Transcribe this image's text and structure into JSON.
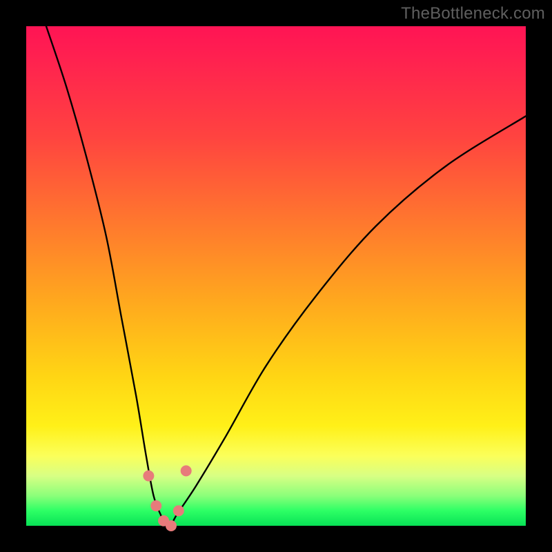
{
  "watermark": "TheBottleneck.com",
  "chart_data": {
    "type": "line",
    "title": "",
    "xlabel": "",
    "ylabel": "",
    "xlim": [
      0,
      100
    ],
    "ylim": [
      0,
      100
    ],
    "gradient_stops": [
      {
        "pos": 0,
        "color": "#ff1454"
      },
      {
        "pos": 22,
        "color": "#ff4340"
      },
      {
        "pos": 40,
        "color": "#ff7a2d"
      },
      {
        "pos": 55,
        "color": "#ffa81e"
      },
      {
        "pos": 70,
        "color": "#ffd514"
      },
      {
        "pos": 80,
        "color": "#fff018"
      },
      {
        "pos": 90,
        "color": "#d8ff84"
      },
      {
        "pos": 100,
        "color": "#08e256"
      }
    ],
    "series": [
      {
        "name": "bottleneck-curve",
        "x": [
          4,
          8,
          12,
          16,
          19,
          22,
          24,
          25.5,
          27,
          28,
          29,
          30,
          34,
          40,
          48,
          58,
          70,
          84,
          100
        ],
        "y": [
          100,
          88,
          74,
          58,
          42,
          26,
          14,
          6,
          2,
          0,
          0,
          2,
          8,
          18,
          32,
          46,
          60,
          72,
          82
        ]
      }
    ],
    "markers": {
      "name": "trough-markers",
      "color": "#e77b7b",
      "radius": 8,
      "points": [
        {
          "x": 24.5,
          "y": 10
        },
        {
          "x": 26.0,
          "y": 4
        },
        {
          "x": 27.5,
          "y": 1
        },
        {
          "x": 29.0,
          "y": 0
        },
        {
          "x": 30.5,
          "y": 3
        },
        {
          "x": 32.0,
          "y": 11
        }
      ]
    }
  }
}
